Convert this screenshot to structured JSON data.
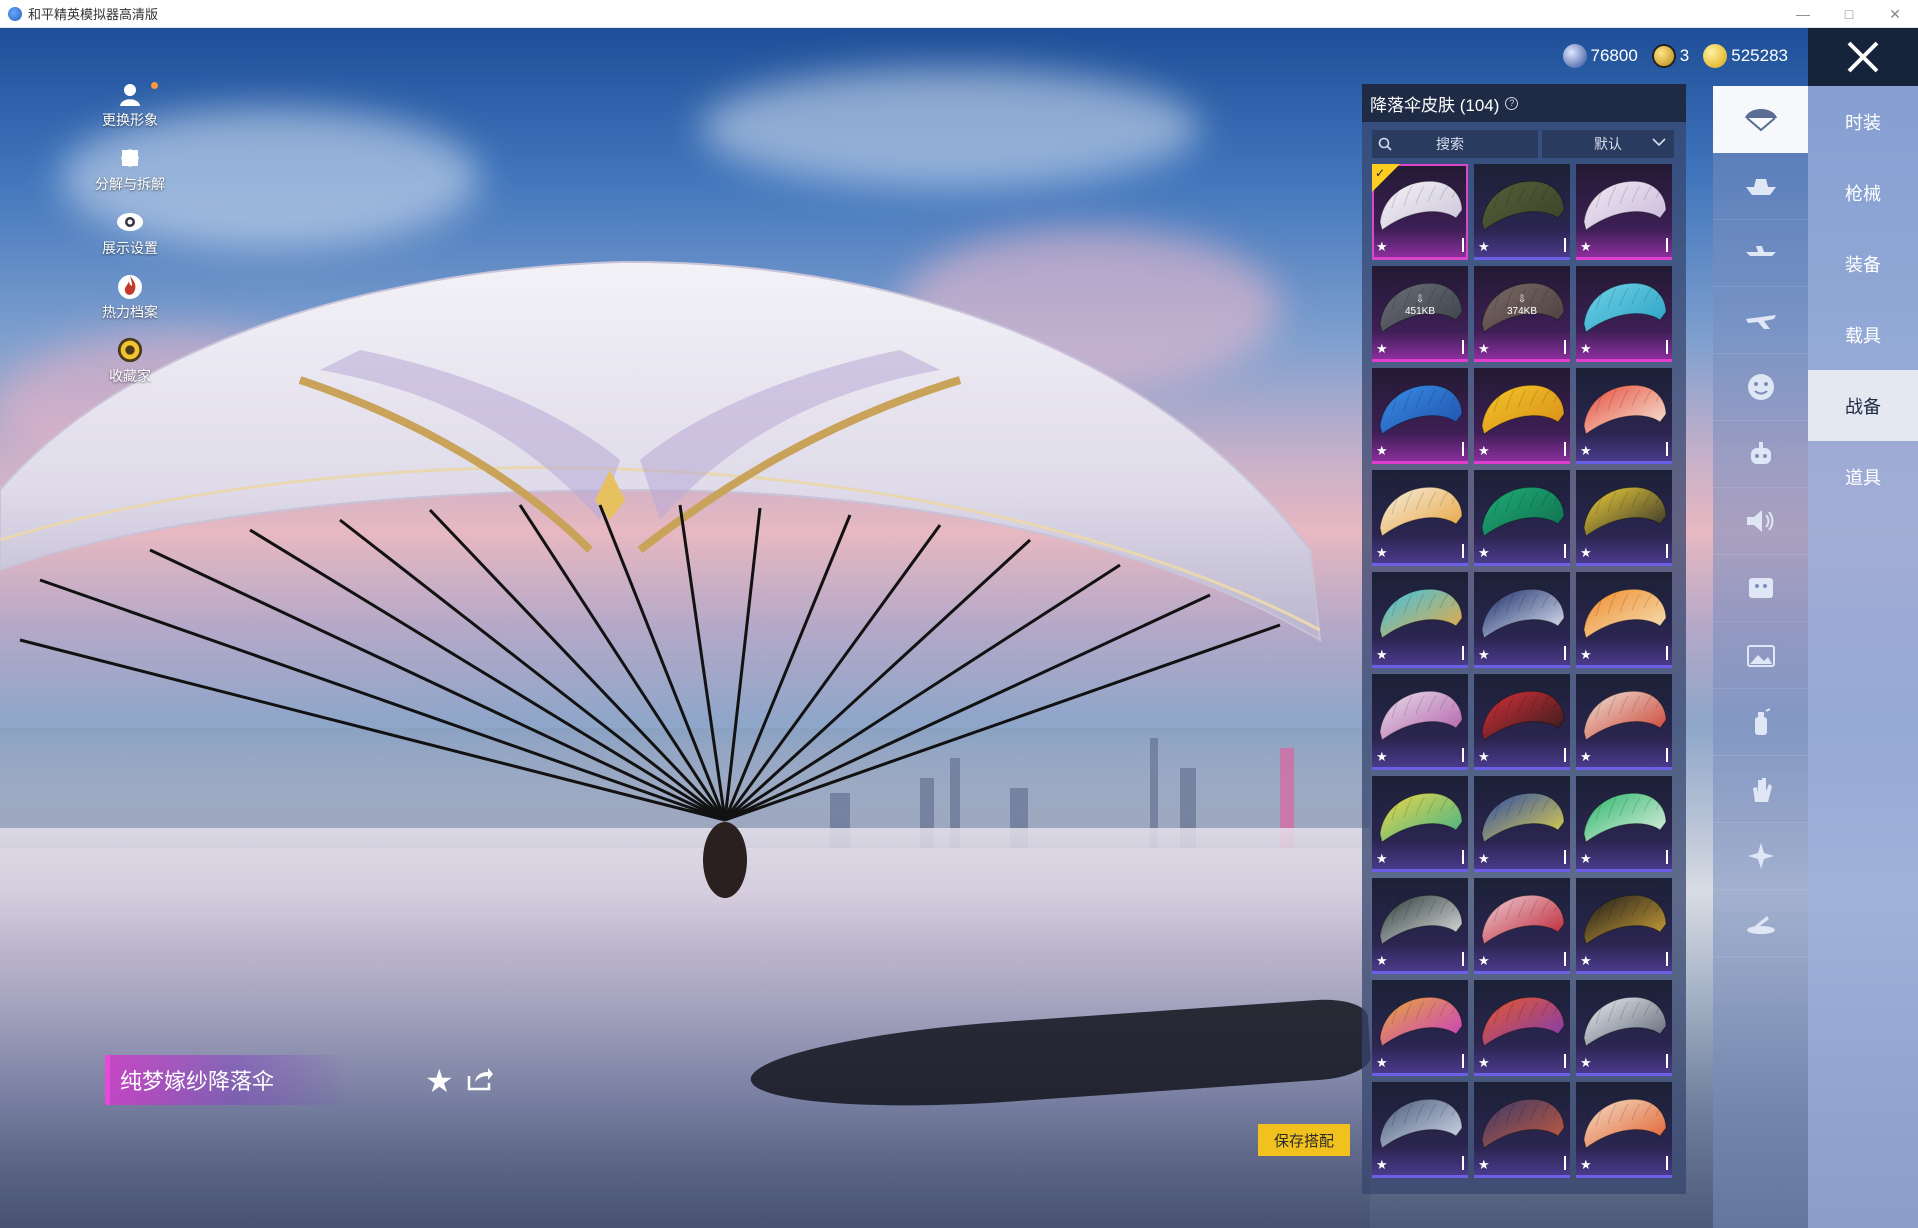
{
  "window": {
    "title": "和平精英模拟器高清版"
  },
  "left_tools": [
    {
      "label": "更换形象"
    },
    {
      "label": "分解与拆解"
    },
    {
      "label": "展示设置"
    },
    {
      "label": "热力档案"
    },
    {
      "label": "收藏家"
    }
  ],
  "currency": {
    "a": "76800",
    "b": "3",
    "c": "525283"
  },
  "categories": [
    "时装",
    "枪械",
    "装备",
    "载具",
    "战备",
    "道具"
  ],
  "active_category": "战备",
  "panel": {
    "title": "降落伞皮肤 (104)",
    "help": "?",
    "search_label": "搜索",
    "sort_label": "默认",
    "skins": [
      {
        "c1": "#f4f2f8",
        "c2": "#c9c4d8",
        "style": "pink",
        "selected": true
      },
      {
        "c1": "#56603a",
        "c2": "#3a4128",
        "style": "blue"
      },
      {
        "c1": "#f0e8f4",
        "c2": "#c9b9d9",
        "style": "pink"
      },
      {
        "c1": "#6a6f78",
        "c2": "#3b3f47",
        "style": "pink",
        "download": "451KB"
      },
      {
        "c1": "#7a6a68",
        "c2": "#4a3d3c",
        "style": "pink",
        "download": "374KB"
      },
      {
        "c1": "#6fd3e8",
        "c2": "#2a9fc3",
        "style": "pink"
      },
      {
        "c1": "#3a8ee8",
        "c2": "#1e4ea8",
        "style": "pink"
      },
      {
        "c1": "#f3c52a",
        "c2": "#d88c18",
        "style": "pink"
      },
      {
        "c1": "#e84a3a",
        "c2": "#f5f0e0",
        "style": "blue"
      },
      {
        "c1": "#f5efe0",
        "c2": "#e8a13a",
        "style": "blue"
      },
      {
        "c1": "#1fae7a",
        "c2": "#0f6b4a",
        "style": "blue"
      },
      {
        "c1": "#f2d23a",
        "c2": "#2a2a2a",
        "style": "blue"
      },
      {
        "c1": "#3ec4e8",
        "c2": "#f0a83a",
        "style": "blue"
      },
      {
        "c1": "#1a2c6a",
        "c2": "#e8eef8",
        "style": "blue"
      },
      {
        "c1": "#f08a2a",
        "c2": "#f5e6c0",
        "style": "blue"
      },
      {
        "c1": "#e8e0ea",
        "c2": "#b05aa8",
        "style": "blue"
      },
      {
        "c1": "#d8313a",
        "c2": "#2a1a1a",
        "style": "blue"
      },
      {
        "c1": "#f0e2d8",
        "c2": "#c83a2a",
        "style": "blue"
      },
      {
        "c1": "#f0d84a",
        "c2": "#3ab08a",
        "style": "blue"
      },
      {
        "c1": "#2a48a8",
        "c2": "#e8d84a",
        "style": "blue"
      },
      {
        "c1": "#2ab86a",
        "c2": "#e8f0e8",
        "style": "blue"
      },
      {
        "c1": "#2a3a3a",
        "c2": "#e8e8e8",
        "style": "blue"
      },
      {
        "c1": "#f0d0d8",
        "c2": "#b81a2a",
        "style": "blue"
      },
      {
        "c1": "#1a1a1a",
        "c2": "#d8a83a",
        "style": "blue"
      },
      {
        "c1": "#e8a83a",
        "c2": "#c83ac8",
        "style": "blue"
      },
      {
        "c1": "#e85a2a",
        "c2": "#7a3ab8",
        "style": "blue"
      },
      {
        "c1": "#e8eef4",
        "c2": "#5a6270",
        "style": "blue"
      },
      {
        "c1": "#4a5a7a",
        "c2": "#d8e0f0",
        "style": "blue"
      },
      {
        "c1": "#3a3a6a",
        "c2": "#c85a3a",
        "style": "blue"
      },
      {
        "c1": "#f5e0c8",
        "c2": "#e05a2a",
        "style": "blue"
      }
    ]
  },
  "item_name": "纯梦嫁纱降落伞",
  "save_label": "保存搭配"
}
